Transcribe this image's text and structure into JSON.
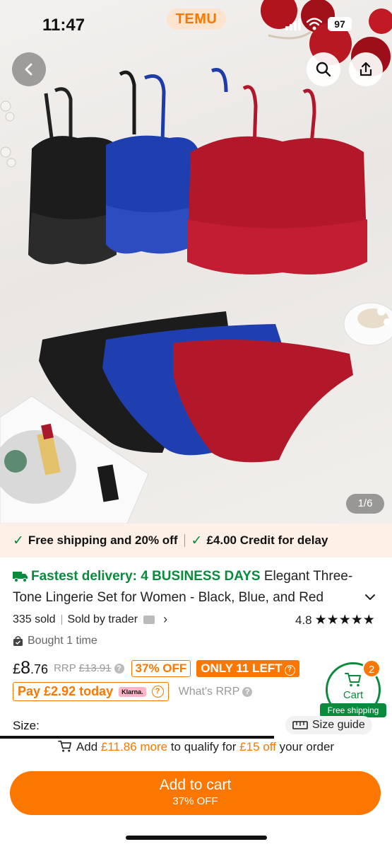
{
  "status_bar": {
    "time": "11:47",
    "battery": "97",
    "brand": "TEMU"
  },
  "image": {
    "counter": "1/6"
  },
  "promo": {
    "shipping": "Free shipping and 20% off",
    "credit": "£4.00 Credit for delay"
  },
  "product": {
    "delivery": "Fastest delivery: 4 BUSINESS DAYS",
    "title": "Elegant Three-Tone Lingerie Set for Women - Black, Blue, and Red",
    "sold": "335 sold",
    "seller": "Sold by trader",
    "rating": "4.8",
    "stars": "★★★★★",
    "bought": "Bought 1 time"
  },
  "price": {
    "currency": "£",
    "whole": "8",
    "decimal": ".76",
    "rrp_label": "RRP",
    "rrp_value": "£13.91",
    "discount": "37% OFF",
    "stock": "ONLY 11 LEFT",
    "pay_today": "Pay £2.92 today",
    "klarna": "Klarna.",
    "whats_rrp": "What's RRP"
  },
  "cart": {
    "label": "Cart",
    "count": "2",
    "shipping": "Free shipping"
  },
  "size": {
    "label": "Size:",
    "guide": "Size guide"
  },
  "qualify": {
    "pre": "Add",
    "amount": "£11.86 more",
    "mid": "to qualify for",
    "offer": "£15 off",
    "post": "your order"
  },
  "cta": {
    "label": "Add to cart",
    "sublabel": "37% OFF"
  },
  "colors": {
    "accent": "#fb7701",
    "green": "#0a8a3c",
    "promo_bg": "#fdf0e6"
  }
}
